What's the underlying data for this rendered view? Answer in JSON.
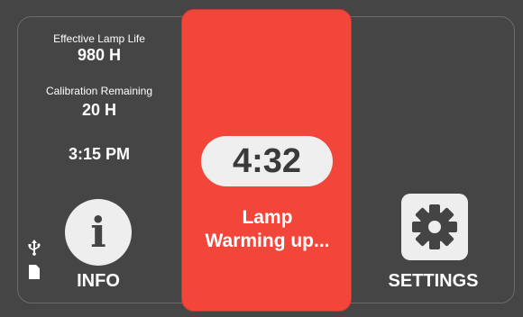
{
  "left": {
    "lamp_life_label": "Effective Lamp Life",
    "lamp_life_value": "980 H",
    "calibration_label": "Calibration Remaining",
    "calibration_value": "20 H",
    "time": "3:15 PM",
    "info_button_icon": "info-icon",
    "info_label": "INFO",
    "status_icons": [
      "usb-icon",
      "sd-card-icon"
    ]
  },
  "center": {
    "timer": "4:32",
    "status_line1": "Lamp",
    "status_line2": "Warming up...",
    "panel_color": "#f2463b"
  },
  "right": {
    "settings_button_icon": "gear-icon",
    "settings_label": "SETTINGS"
  },
  "colors": {
    "background": "#454545",
    "button_fill": "#eeeeee",
    "warning": "#f2463b"
  }
}
